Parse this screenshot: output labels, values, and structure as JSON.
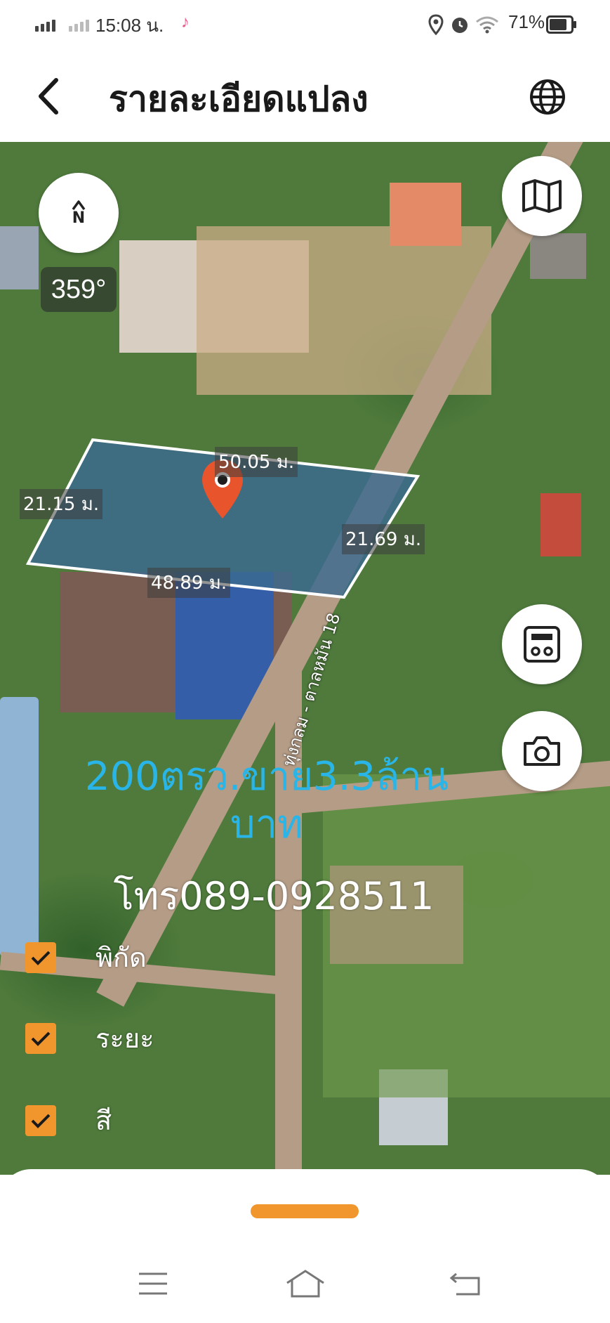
{
  "status_bar": {
    "time": "15:08 น.",
    "battery": "71%"
  },
  "header": {
    "title": "รายละเอียดแปลง",
    "back_icon": "back-arrow-icon",
    "language_icon": "globe-icon"
  },
  "map": {
    "compass_label": "N",
    "heading": "359°",
    "plot_dimensions": {
      "top": "50.05 ม.",
      "left": "21.15 ม.",
      "right": "21.69 ม.",
      "bottom": "48.89 ม."
    },
    "road_label": "ทุ่งกลม - ตาลหมัน 18",
    "listing_text_line1": "200ตรว.ขาย3.3ล้าน",
    "listing_text_line2": "บาท",
    "phone_text": "โทร089-0928511",
    "colors": {
      "plot_fill": "#3a6a90",
      "price_text": "#29b5e8",
      "accent": "#f0962c",
      "marker": "#e8542c"
    }
  },
  "toggles": [
    {
      "label": "พิกัด",
      "checked": true
    },
    {
      "label": "ระยะ",
      "checked": true
    },
    {
      "label": "สี",
      "checked": true
    }
  ],
  "side_buttons": [
    "map-layers-icon",
    "calculator-icon",
    "camera-icon"
  ],
  "bottom_nav": [
    "menu-icon",
    "home-icon",
    "back-nav-icon"
  ]
}
